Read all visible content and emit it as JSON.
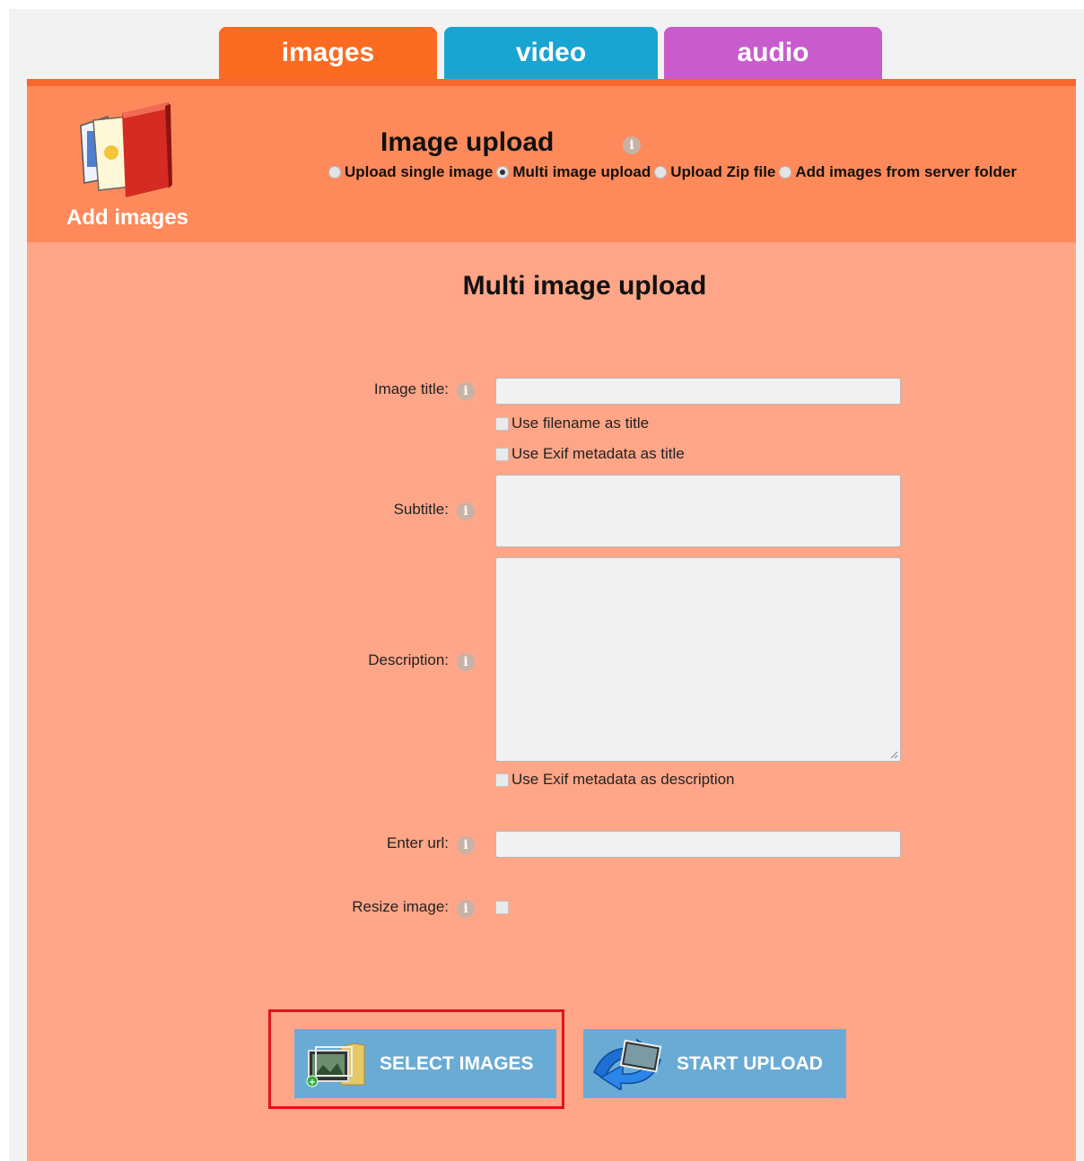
{
  "tabs": [
    {
      "label": "images",
      "color": "#fb6b21",
      "active": true
    },
    {
      "label": "video",
      "color": "#19a5d1"
    },
    {
      "label": "audio",
      "color": "#c95ccc"
    }
  ],
  "header": {
    "section_label": "Add images",
    "title": "Image upload",
    "info_icon": "info-icon",
    "modes": [
      {
        "label": "Upload single image",
        "selected": false
      },
      {
        "label": "Multi image upload",
        "selected": true
      },
      {
        "label": "Upload Zip file",
        "selected": false
      },
      {
        "label": "Add images from server folder",
        "selected": false
      }
    ]
  },
  "form": {
    "title": "Multi image upload",
    "image_title_label": "Image title:",
    "image_title_value": "",
    "use_filename_label": "Use filename as title",
    "use_exif_title_label": "Use Exif metadata as title",
    "subtitle_label": "Subtitle:",
    "subtitle_value": "",
    "description_label": "Description:",
    "description_value": "",
    "use_exif_desc_label": "Use Exif metadata as description",
    "url_label": "Enter url:",
    "url_value": "",
    "resize_label": "Resize image:"
  },
  "buttons": {
    "select_images": "SELECT IMAGES",
    "start_upload": "START UPLOAD"
  },
  "colors": {
    "header_bg": "#fe8a5b",
    "main_bg": "#fea687",
    "button_bg": "#6aabd5",
    "highlight": "#e0151b"
  }
}
